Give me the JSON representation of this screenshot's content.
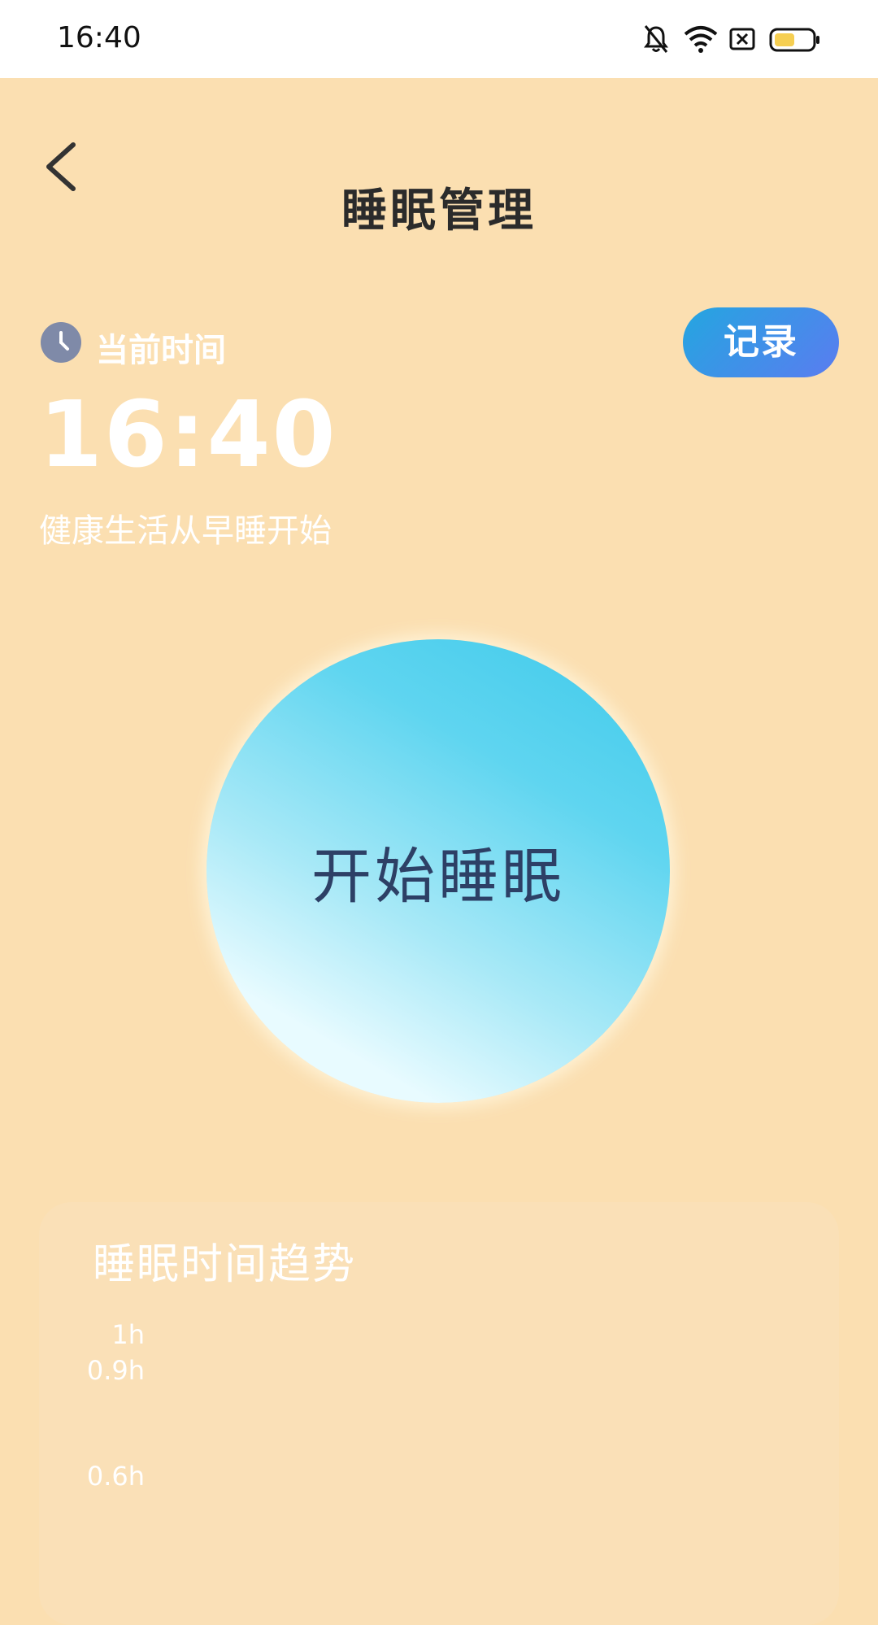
{
  "status_bar": {
    "time": "16:40",
    "icons": [
      "mute-bell-icon",
      "wifi-icon",
      "sim-x-icon",
      "battery-icon"
    ]
  },
  "header": {
    "back_icon": "chevron-left-icon",
    "title": "睡眠管理"
  },
  "current": {
    "label": "当前时间",
    "icon": "clock-icon",
    "time": "16:40",
    "tagline": "健康生活从早睡开始"
  },
  "record_button": {
    "label": "记录"
  },
  "start_button": {
    "label": "开始睡眠"
  },
  "trend": {
    "title": "睡眠时间趋势",
    "y_ticks": [
      "1h",
      "0.9h",
      "0.6h"
    ]
  },
  "colors": {
    "background": "#fbdfb1",
    "record_gradient": [
      "#24a6e0",
      "#5a7cf0"
    ],
    "circle_gradient": [
      "#3ec9ea",
      "#e8fbff"
    ]
  }
}
